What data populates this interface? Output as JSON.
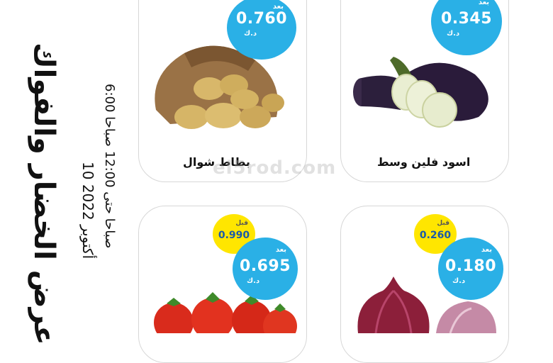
{
  "title": "عرض الخضار والفواك",
  "date_line": "10 أكتوبر 2022",
  "time_line": "6:00 صباحا حتى 12:00 صباحا",
  "watermark": "el5rod.com",
  "price_unit": "د.ك",
  "price_prefix": "بعد",
  "old_prefix": "قبل",
  "products": [
    {
      "name": "بطاط شوال",
      "price": "0.760"
    },
    {
      "name": "اسود فلين وسط",
      "price": "0.345"
    },
    {
      "name": "",
      "price": "0.695",
      "old_price": "0.990"
    },
    {
      "name": "",
      "price": "0.180",
      "old_price": "0.260"
    }
  ],
  "colors": {
    "price_badge": "#2ab0e6",
    "old_badge": "#ffe600",
    "card_border": "#d7d7d7"
  }
}
